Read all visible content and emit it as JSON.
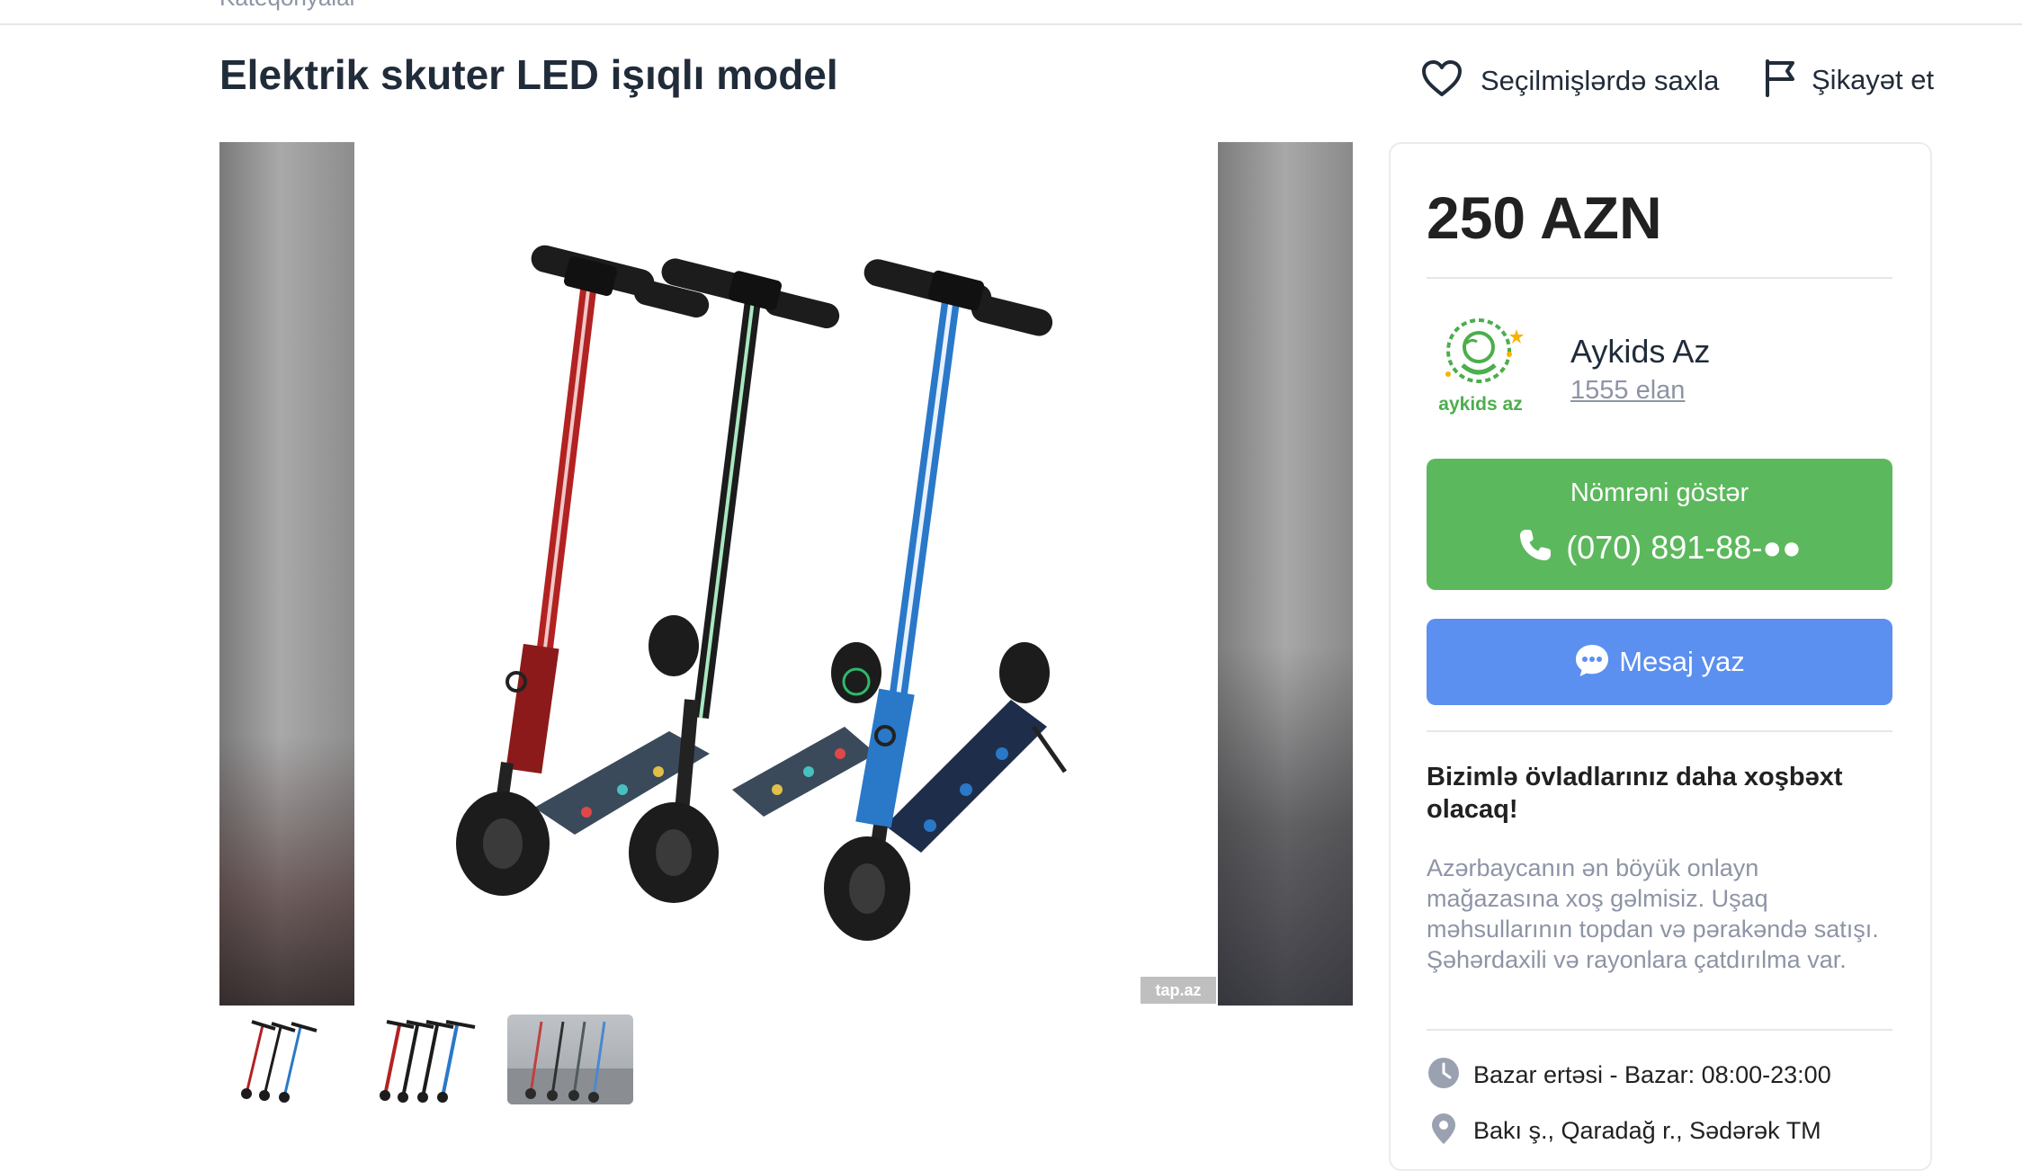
{
  "topbar": {
    "cut_text": "Kateqoriyalar"
  },
  "listing": {
    "title": "Elektrik skuter LED işıqlı model",
    "favorite_label": "Seçilmişlərdə saxla",
    "report_label": "Şikayət et"
  },
  "gallery": {
    "watermark": "tap.az",
    "thumbnail_count": 3
  },
  "seller": {
    "price": "250 AZN",
    "logo_text": "aykids az",
    "name": "Aykids Az",
    "ads_count": "1555 elan",
    "phone_button_label": "Nömrəni göstər",
    "phone_masked": "(070) 891-88-●●",
    "message_button_label": "Mesaj yaz",
    "slogan": "Bizimlə övladlarınız daha xoşbəxt olacaq!",
    "description": "Azərbaycanın ən böyük onlayn mağazasına xoş gəlmisiz. Uşaq məhsullarının topdan və pərakəndə satışı. Şəhərdaxili və rayonlara çatdırılma var.",
    "hours": "Bazar ertəsi - Bazar: 08:00-23:00",
    "address": "Bakı ş., Qaradağ r., Sədərək TM"
  },
  "colors": {
    "phone_button": "#5cb85c",
    "message_button": "#5b8ff0",
    "scooter_red": "#b32222",
    "scooter_green": "#1e6b3a",
    "scooter_blue": "#2a78c8",
    "logo_green": "#4cae4c",
    "logo_star": "#f5b400"
  }
}
